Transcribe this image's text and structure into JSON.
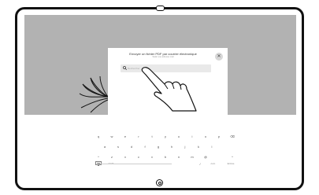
{
  "dialog": {
    "title": "Envoyer un fichier PDF par courrier électronique",
    "subtitle": "Saisir une adresse mail",
    "close_glyph": "✕",
    "search": {
      "icon": "search-icon",
      "placeholder": "Rechercher"
    }
  },
  "keyboard": {
    "row1": [
      "q",
      "w",
      "e",
      "r",
      "t",
      "y",
      "u",
      "i",
      "o",
      "p",
      "⌫"
    ],
    "row2": [
      "a",
      "s",
      "d",
      "f",
      "g",
      "h",
      "j",
      "k",
      "l"
    ],
    "row3": [
      "^",
      "z",
      "x",
      "c",
      "v",
      "b",
      "n",
      "m",
      "@",
      "^"
    ],
    "row4": {
      "emoji_icon": "keyboard-icon",
      "numbers": "?123",
      "slash": "/",
      "dotcom": ".com",
      "enter": "Entrée"
    }
  }
}
